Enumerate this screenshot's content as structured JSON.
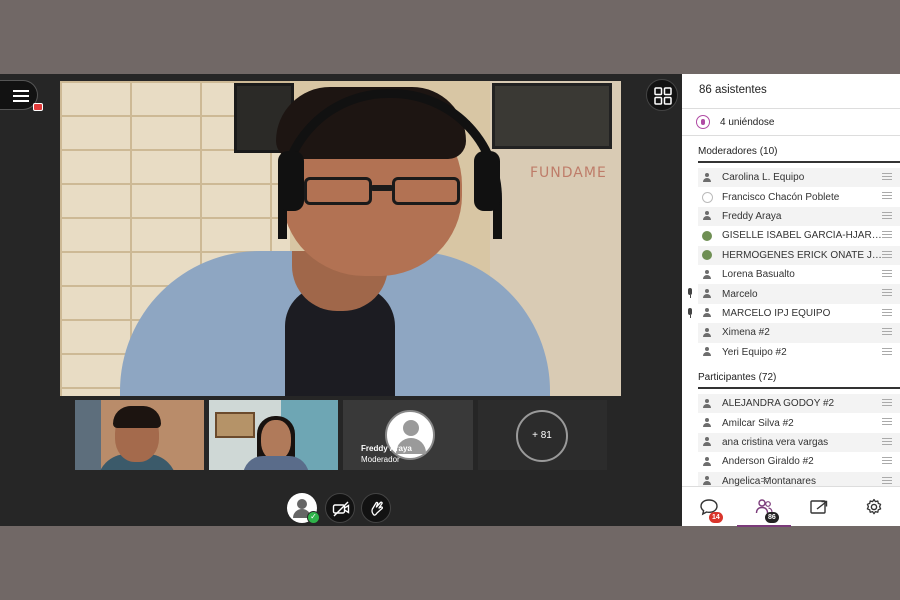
{
  "stage": {
    "main_speaker_overlay_text": "FUNDAME",
    "thumbnails": [
      {
        "kind": "video",
        "participant": ""
      },
      {
        "kind": "video",
        "participant": ""
      },
      {
        "kind": "avatar",
        "name": "Freddy Araya",
        "role": "Moderador"
      },
      {
        "kind": "overflow",
        "label": "+ 81"
      }
    ],
    "controls": [
      {
        "icon": "user-status-icon"
      },
      {
        "icon": "camera-off-icon"
      },
      {
        "icon": "raise-hand-icon"
      }
    ]
  },
  "panel": {
    "attendees_count": "86 asistentes",
    "joining": "4 uniéndose",
    "moderators_title": "Moderadores (10)",
    "moderators": [
      {
        "name": "Carolina L. Equipo",
        "mic": false
      },
      {
        "name": "Francisco Chacón Poblete",
        "mic": false
      },
      {
        "name": "Freddy Araya",
        "mic": false
      },
      {
        "name": "GISELLE ISABEL GARCÍA-HJARLES...",
        "mic": false
      },
      {
        "name": "HERMÓGENES ERICK OÑATE JOR...",
        "mic": false
      },
      {
        "name": "Lorena Basualto",
        "mic": false
      },
      {
        "name": "Marcelo",
        "mic": true
      },
      {
        "name": "MARCELO IPJ EQUIPO",
        "mic": true
      },
      {
        "name": "Ximena #2",
        "mic": false
      },
      {
        "name": "Yeri Equipo #2",
        "mic": false
      }
    ],
    "participants_title": "Participantes (72)",
    "participants": [
      {
        "name": "ALEJANDRA GODOY #2"
      },
      {
        "name": "Amilcar Silva #2"
      },
      {
        "name": "ana cristina vera vargas"
      },
      {
        "name": "Anderson Giraldo #2"
      },
      {
        "name": "Angelica Montanares"
      }
    ],
    "tabs": {
      "chat_badge": "14",
      "attendees_badge": "86"
    }
  },
  "colors": {
    "accent": "#7b3b7a",
    "badge_red": "#d9352b",
    "status_green": "#2fb34a",
    "stage_bg": "#262626"
  }
}
